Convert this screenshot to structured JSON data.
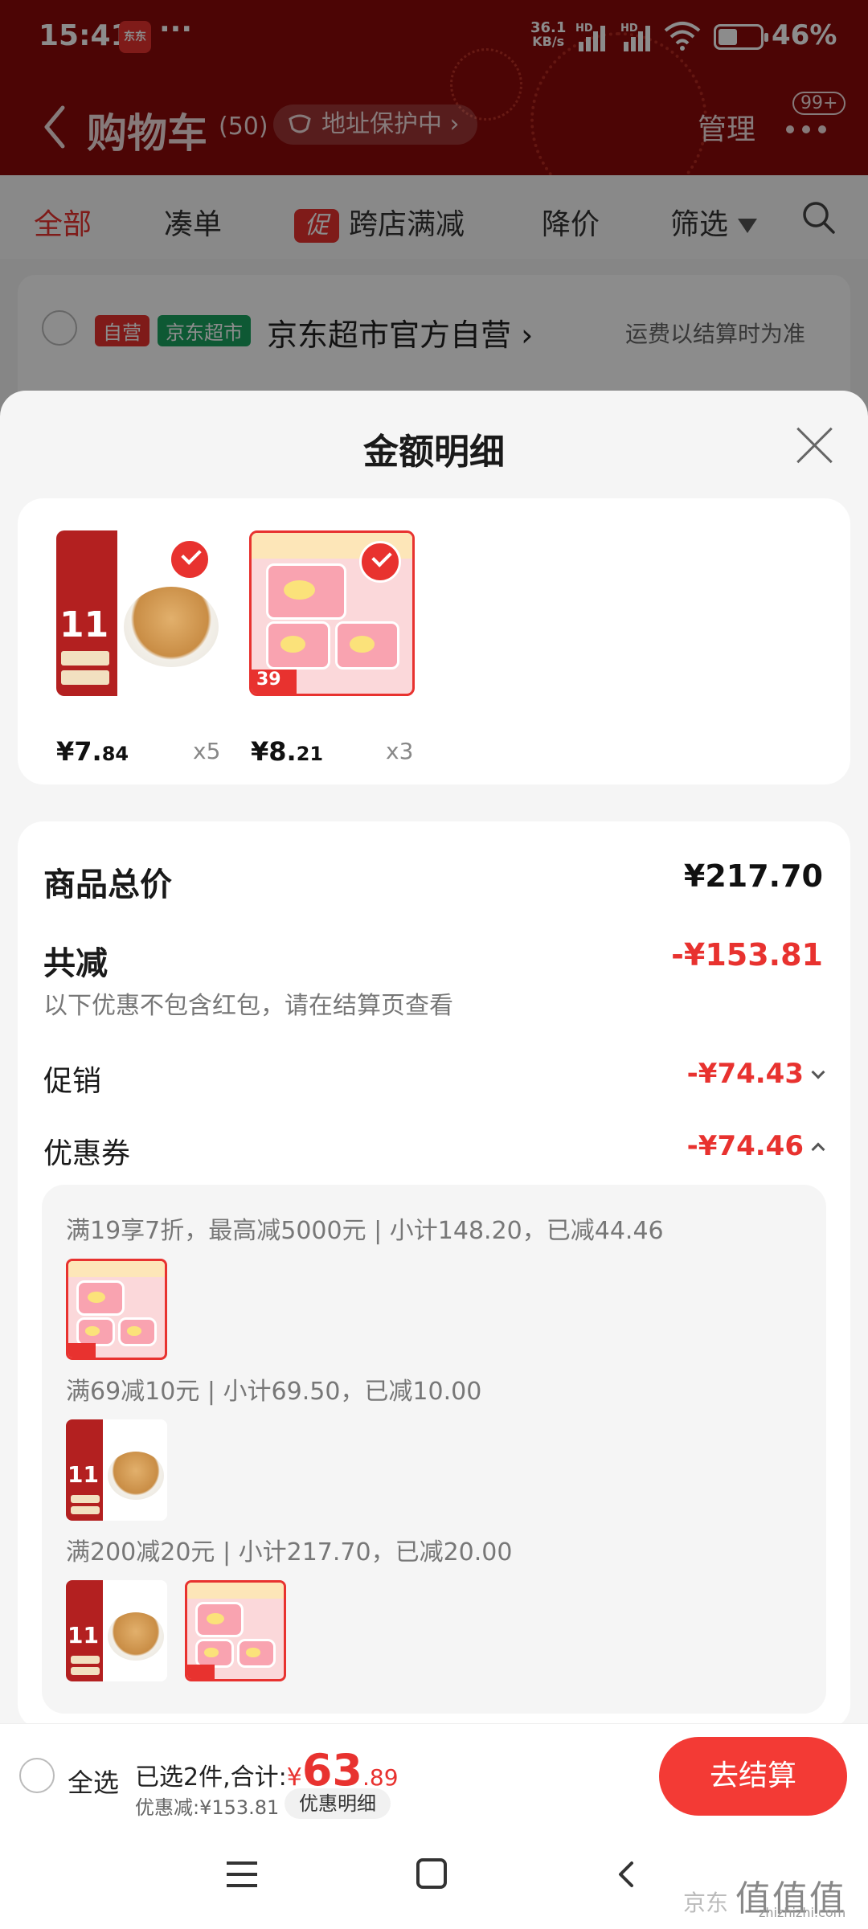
{
  "status_bar": {
    "time": "15:41",
    "app_badge": "东东",
    "more_dots": "···",
    "net_speed_top": "36.1",
    "net_speed_bottom": "KB/s",
    "hd1": "HD",
    "hd2": "HD",
    "battery_level": 0.46,
    "battery_pct": "46%"
  },
  "header": {
    "title": "购物车",
    "count": "(50)",
    "address_protect": "地址保护中 ›",
    "manage": "管理",
    "badge": "99+"
  },
  "tabs": {
    "all": "全部",
    "bundle": "凑单",
    "cross_store_tag": "促",
    "cross_store": "跨店满减",
    "price_drop": "降价",
    "filter": "筛选"
  },
  "store": {
    "tag_self": "自营",
    "tag_market": "京东超市",
    "name": "京东超市官方自营 ›",
    "shipping_note": "运费以结算时为准"
  },
  "sheet": {
    "title": "金额明细",
    "items": [
      {
        "price_main": "¥7.",
        "price_cents": "84",
        "qty": "x5",
        "art_text": "11"
      },
      {
        "price_main": "¥8.",
        "price_cents": "21",
        "qty": "x3",
        "art_text": "39"
      }
    ],
    "total_label": "商品总价",
    "total_value": "¥217.70",
    "discount_label": "共减",
    "discount_value": "-¥153.81",
    "discount_note": "以下优惠不包含红包，请在结算页查看",
    "promo_label": "促销",
    "promo_value": "-¥74.43",
    "coupon_label": "优惠券",
    "coupon_value": "-¥74.46",
    "coupons": [
      {
        "text": "满19享7折，最高减5000元 | 小计148.20，已减44.46"
      },
      {
        "text": "满69减10元 | 小计69.50，已减10.00"
      },
      {
        "text": "满200减20元 | 小计217.70，已减20.00"
      }
    ]
  },
  "checkout": {
    "select_all": "全选",
    "selected_prefix": "已选2件,合计:",
    "yen": "¥",
    "amount": "63",
    "cents": ".89",
    "saved": "优惠减:¥153.81",
    "detail_chip": "优惠明细",
    "pay_button": "去结算"
  },
  "watermark": {
    "text": "京东",
    "logo": "值值值",
    "url": "zhizhizhi.com"
  },
  "colors": {
    "brand_red": "#e8322f",
    "header_red": "#8a0a0a",
    "market_green": "#1aa260"
  }
}
